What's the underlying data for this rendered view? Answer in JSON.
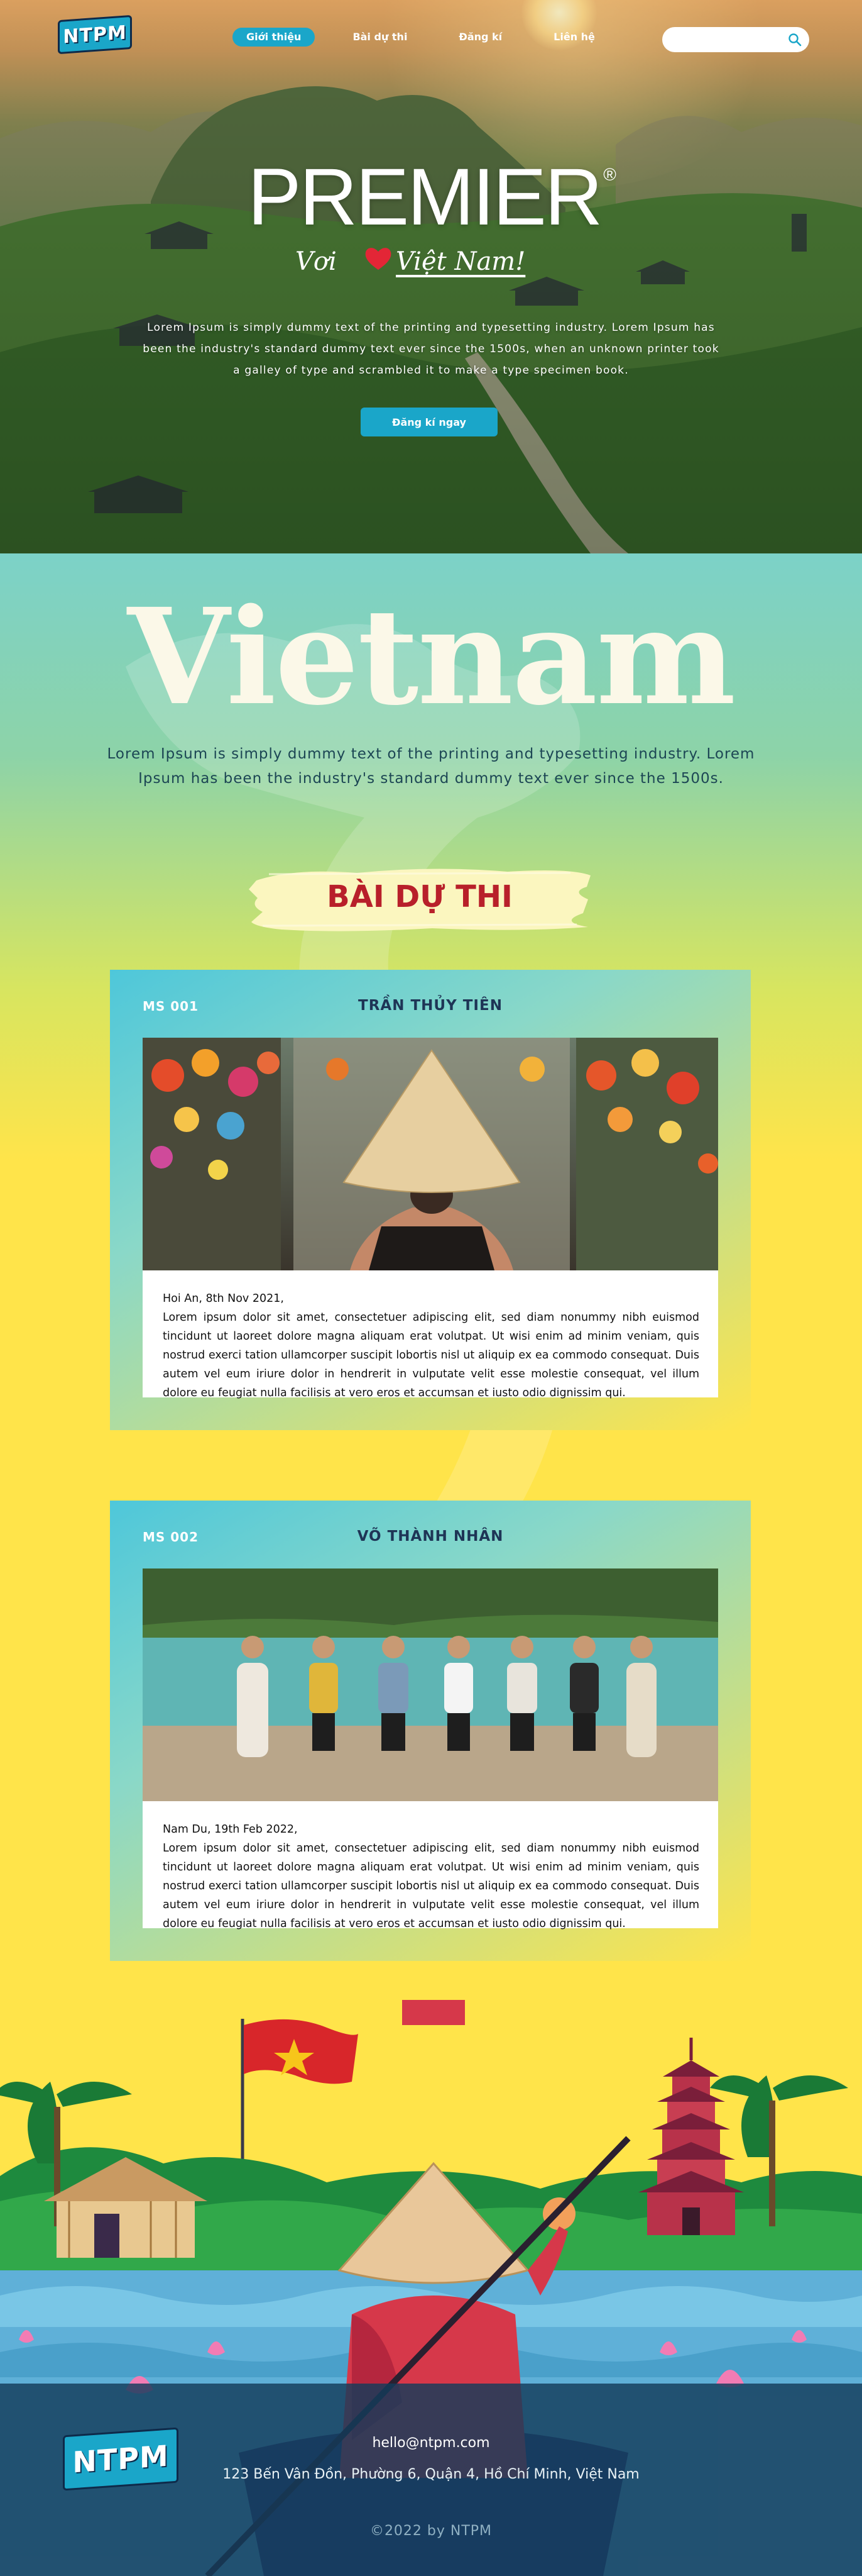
{
  "header": {
    "logo_text": "NTPM",
    "nav": [
      {
        "label": "Giới thiệu",
        "active": true
      },
      {
        "label": "Bài dự thi",
        "active": false
      },
      {
        "label": "Đăng kí",
        "active": false
      },
      {
        "label": "Liên hệ",
        "active": false
      }
    ],
    "search": {
      "value": "",
      "placeholder": "",
      "icon": "search-icon"
    }
  },
  "hero": {
    "brand": "PREMIER",
    "brand_mark": "®",
    "tagline_pre": "Vơi",
    "tagline_heart": "heart-icon",
    "tagline_post": "Việt Nam!",
    "description": "Lorem Ipsum is simply dummy text of the printing and typesetting industry. Lorem Ipsum has been the industry's standard dummy text ever since the 1500s, when an unknown printer took a galley of type and scrambled it to make a type specimen book.",
    "cta_label": "Đăng kí ngay"
  },
  "intro": {
    "title": "Vietnam",
    "description": "Lorem Ipsum is simply dummy text of the printing and typesetting industry. Lorem Ipsum has been the industry's standard dummy text ever since the 1500s."
  },
  "section": {
    "title": "BÀI DỰ THI"
  },
  "entries": [
    {
      "ms": "MS 001",
      "name": "TRẦN THỦY TIÊN",
      "date": "Hoi An, 8th Nov 2021,",
      "text": "Lorem ipsum dolor sit amet, consectetuer adipiscing elit, sed diam nonummy nibh euismod tincidunt ut laoreet dolore magna aliquam erat volutpat. Ut wisi enim ad minim veniam, quis nostrud exerci tation ullamcorper suscipit lobortis nisl ut aliquip ex ea commodo consequat. Duis autem vel eum iriure dolor in hendrerit in vulputate velit esse molestie consequat, vel illum dolore eu feugiat nulla facilisis at vero eros et accumsan et iusto odio dignissim qui."
    },
    {
      "ms": "MS 002",
      "name": "VÕ THÀNH NHÂN",
      "date": "Nam Du, 19th Feb 2022,",
      "text": "Lorem ipsum dolor sit amet, consectetuer adipiscing elit, sed diam nonummy nibh euismod tincidunt ut laoreet dolore magna aliquam erat volutpat. Ut wisi enim ad minim veniam, quis nostrud exerci tation ullamcorper suscipit lobortis nisl ut aliquip ex ea commodo consequat. Duis autem vel eum iriure dolor in hendrerit in vulputate velit esse molestie consequat, vel illum dolore eu feugiat nulla facilisis at vero eros et accumsan et iusto odio dignissim qui."
    }
  ],
  "footer": {
    "logo_text": "NTPM",
    "email": "hello@ntpm.com",
    "address": "123 Bến Vân Đồn, Phường 6, Quận 4, Hồ Chí Minh, Việt Nam",
    "copyright": "©2022 by NTPM"
  },
  "colors": {
    "accent": "#1aa6c9",
    "title_red": "#b8202a",
    "yellow": "#ffe44a",
    "navy": "#1e3556"
  }
}
